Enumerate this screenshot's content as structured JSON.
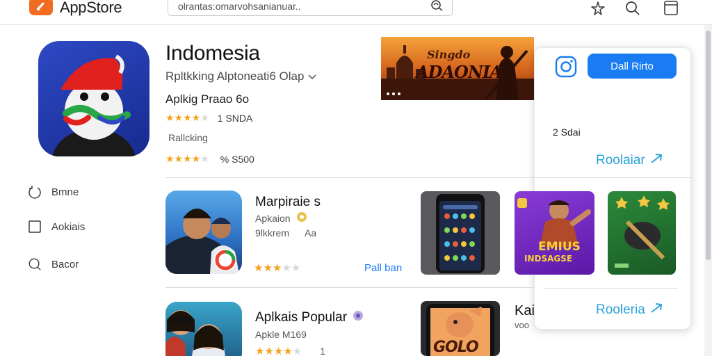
{
  "header": {
    "app_title": "AppStore",
    "search_value": "olrantas:omarvohsanianuar.."
  },
  "sidebar": {
    "items": [
      {
        "label": "Bmne",
        "icon": "circle-arrow-icon"
      },
      {
        "label": "Aokiais",
        "icon": "square-icon"
      },
      {
        "label": "Bacor",
        "icon": "search-icon"
      }
    ]
  },
  "hero": {
    "title": "Indomesia",
    "subtitle": "Rpltkking  Alptoneati6 Olap",
    "line": "Aplkig Praao 6o",
    "rating1_text": "1 SNDA",
    "ranking_label": "Rallcking",
    "rating2_text": "% S500",
    "banner_text_line1": "Singdo",
    "banner_text_line2": "ADAONIA"
  },
  "popover": {
    "primary_button": "Dall Rirto",
    "count": "2 Sdai",
    "link1": "Roolaiar",
    "link2": "Rooleria"
  },
  "rows": [
    {
      "title": "Marpiraie s",
      "sub1": "Apkaion",
      "sub2_a": "9lkkrem",
      "sub2_b": "Aa",
      "get": "Pall ban"
    },
    {
      "title": "Aplkais Popular",
      "sub1": "Apkle M169",
      "sub2_a": "1"
    }
  ],
  "cards": {
    "game_text_line1": "EMIUS",
    "game_text_line2": "INDSAGSE",
    "peek_title": "Kai",
    "peek_sub": "voo",
    "phone2_text": "GOLO"
  },
  "colors": {
    "accent": "#1a7cf2",
    "link": "#2aa3d8",
    "logo": "#f26b22",
    "star": "#f4a21b"
  }
}
